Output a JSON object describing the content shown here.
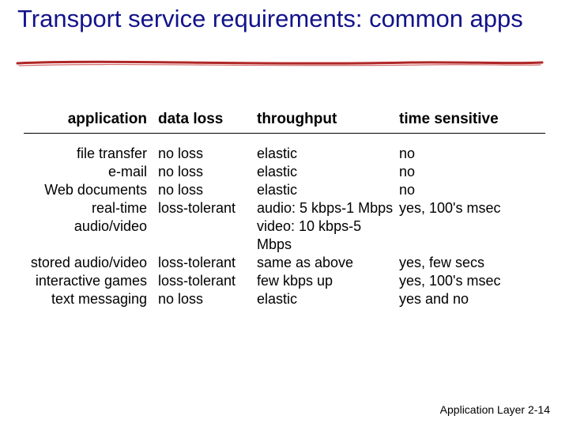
{
  "title": "Transport service requirements: common apps",
  "headers": {
    "application": "application",
    "data_loss": "data loss",
    "throughput": "throughput",
    "time_sensitive": "time sensitive"
  },
  "rows": [
    {
      "application": "file transfer",
      "data_loss": "no loss",
      "throughput": "elastic",
      "time_sensitive": "no"
    },
    {
      "application": "e-mail",
      "data_loss": "no loss",
      "throughput": "elastic",
      "time_sensitive": "no"
    },
    {
      "application": "Web documents",
      "data_loss": "no loss",
      "throughput": "elastic",
      "time_sensitive": "no"
    },
    {
      "application": "real-time audio/video",
      "data_loss": "loss-tolerant",
      "throughput": "audio: 5 kbps-1 Mbps\nvideo: 10 kbps-5 Mbps",
      "time_sensitive": "yes, 100's msec"
    },
    {
      "application": "stored audio/video",
      "data_loss": "loss-tolerant",
      "throughput": "same as above",
      "time_sensitive": "yes, few secs"
    },
    {
      "application": "interactive games",
      "data_loss": "loss-tolerant",
      "throughput": "few kbps up",
      "time_sensitive": "yes, 100's msec"
    },
    {
      "application": "text messaging",
      "data_loss": "no loss",
      "throughput": "elastic",
      "time_sensitive": "yes and no"
    }
  ],
  "footer": {
    "label": "Application Layer",
    "page": "2-14"
  },
  "chart_data": {
    "type": "table",
    "title": "Transport service requirements: common apps",
    "columns": [
      "application",
      "data loss",
      "throughput",
      "time sensitive"
    ],
    "rows": [
      [
        "file transfer",
        "no loss",
        "elastic",
        "no"
      ],
      [
        "e-mail",
        "no loss",
        "elastic",
        "no"
      ],
      [
        "Web documents",
        "no loss",
        "elastic",
        "no"
      ],
      [
        "real-time audio/video",
        "loss-tolerant",
        "audio: 5 kbps-1 Mbps; video: 10 kbps-5 Mbps",
        "yes, 100's msec"
      ],
      [
        "stored audio/video",
        "loss-tolerant",
        "same as above",
        "yes, few secs"
      ],
      [
        "interactive games",
        "loss-tolerant",
        "few kbps up",
        "yes, 100's msec"
      ],
      [
        "text messaging",
        "no loss",
        "elastic",
        "yes and no"
      ]
    ]
  }
}
